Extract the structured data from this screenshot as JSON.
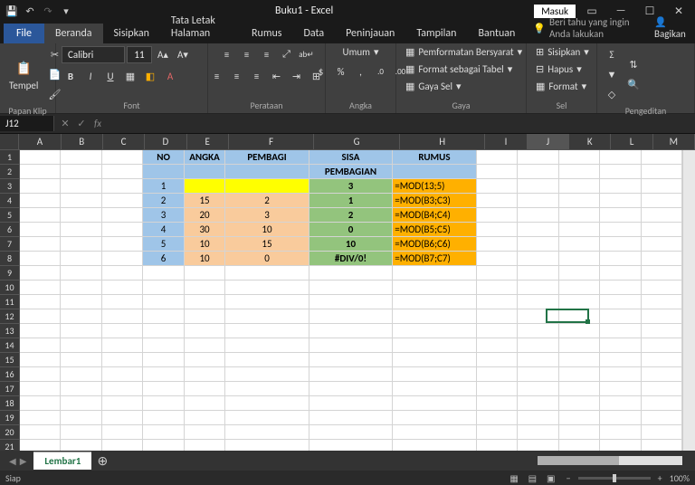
{
  "title": "Buku1 - Excel",
  "masuk": "Masuk",
  "tabs": {
    "file": "File",
    "items": [
      "Beranda",
      "Sisipkan",
      "Tata Letak Halaman",
      "Rumus",
      "Data",
      "Peninjauan",
      "Tampilan",
      "Bantuan"
    ],
    "tell": "Beri tahu yang ingin Anda lakukan",
    "share": "Bagikan"
  },
  "ribbon": {
    "clipboard": {
      "paste": "Tempel",
      "label": "Papan Klip"
    },
    "font": {
      "name": "Calibri",
      "size": "11",
      "label": "Font"
    },
    "align": {
      "label": "Perataan"
    },
    "number": {
      "format": "Umum",
      "label": "Angka"
    },
    "styles": {
      "cond": "Pemformatan Bersyarat",
      "table": "Format sebagai Tabel",
      "cell": "Gaya Sel",
      "label": "Gaya"
    },
    "cells": {
      "insert": "Sisipkan",
      "delete": "Hapus",
      "format": "Format",
      "label": "Sel"
    },
    "editing": {
      "label": "Pengeditan"
    }
  },
  "namebox": "J12",
  "cols": [
    "A",
    "B",
    "C",
    "D",
    "E",
    "F",
    "G",
    "H",
    "I",
    "J",
    "K",
    "L",
    "M"
  ],
  "activeCol": "J",
  "activeRow": 12,
  "headers": {
    "no": "NO",
    "angka": "ANGKA",
    "pembagi": "PEMBAGI",
    "sisa": "SISA",
    "sisa2": "PEMBAGIAN",
    "rumus": "RUMUS"
  },
  "rows": [
    {
      "no": "1",
      "a": "",
      "p": "",
      "s": "3",
      "r": "=MOD(13;5)"
    },
    {
      "no": "2",
      "a": "15",
      "p": "2",
      "s": "1",
      "r": "=MOD(B3;C3)"
    },
    {
      "no": "3",
      "a": "20",
      "p": "3",
      "s": "2",
      "r": "=MOD(B4;C4)"
    },
    {
      "no": "4",
      "a": "30",
      "p": "10",
      "s": "0",
      "r": "=MOD(B5;C5)"
    },
    {
      "no": "5",
      "a": "10",
      "p": "15",
      "s": "10",
      "r": "=MOD(B6;C6)"
    },
    {
      "no": "6",
      "a": "10",
      "p": "0",
      "s": "#DIV/0!",
      "r": "=MOD(B7;C7)"
    }
  ],
  "sheet": "Lembar1",
  "status": {
    "ready": "Siap",
    "zoom": "100%"
  }
}
